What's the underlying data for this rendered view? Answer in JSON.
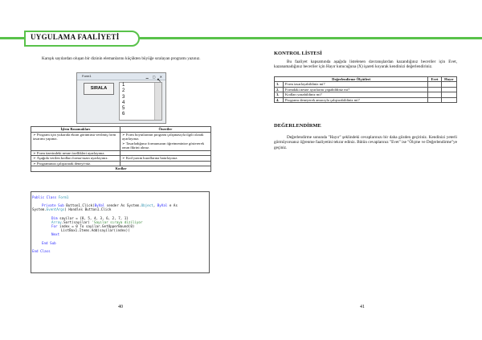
{
  "header": {
    "title": "UYGULAMA FAALİYETİ"
  },
  "left": {
    "intro": "Karışık sayılardan oluşan bir dizinin elemanlarını küçükten büyüğe sıralayan programı yazınız.",
    "window": {
      "title": "Form1",
      "button": "SIRALA",
      "items": [
        "1",
        "2",
        "3",
        "4",
        "5",
        "6"
      ]
    },
    "table": {
      "headers": [
        "İşlem Basamakları",
        "Öneriler"
      ],
      "rows": [
        [
          "➢ Program için yukarıda ekran görüntüsü verilmiş form tasarımı yapınız.",
          "➢ Form boyutlarının program çalışmasıyla ilgili olarak ayarlayınız.\n➢ Tasarladığınız formunuzun öğretmeninize göstererek onun fikrini alınız."
        ],
        [
          "➢ Form üzerindeki nesne özellikleri ayarlayınız.",
          ""
        ],
        [
          "➢ Aşağıda verilen kodları forma-nızın uyarlayınız.",
          "➢ Kod yazım kurallarına hatırlayınız."
        ],
        [
          "➢ Programınızı çalıştırarak deneyi-niz.",
          ""
        ]
      ],
      "code_header": "Kodlar"
    },
    "code": {
      "l1a": "Public Class ",
      "l1b": "Form1",
      "l2a": "Private Sub ",
      "l2b": "Button1_Click(",
      "l2c": "ByVal ",
      "l2d": "sender As System.",
      "l2e": "Object",
      ", ": "",
      "l2f": ", ",
      "l2g": "ByVal ",
      "l2h": "e As",
      "l3a": "System.",
      "l3b": "EventArgs",
      "l3c": ") Handles Button1.Click",
      "l4a": "Dim ",
      "l4b": "sayilar = {8, 5, 4, 3, 6, 2, 7, 1}",
      "l5a": "Array",
      "l5b": ".Sort(sayilar) ",
      "l5c": "'Sayılar sıraya diziliyor",
      "l6a": "For ",
      "l6b": "index = 0 To sayilar.GetUpperBound(0)",
      "l7": "ListBox1.Items.Add(sayilar(index))",
      "l8": "Next",
      "l9": "End Sub",
      "l10": "End Class"
    },
    "page_number": "40"
  },
  "right": {
    "checklist_title": "KONTROL LİSTESİ",
    "checklist_intro": "Bu faaliyet kapsamında aşağıda listelenen davranışlardan kazandığınız beceriler için Evet, kazanamadığınız beceriler için Hayır kutucuğuna (X) işareti koyarak kendinizi değerlendiriniz.",
    "checklist_headers": [
      "Değerlendirme Ölçütleri",
      "Evet",
      "Hayır"
    ],
    "checklist_rows": [
      {
        "num": "1.",
        "text": "Form tasarlayabildiniz mi?"
      },
      {
        "num": "2.",
        "text": "Formdaki nesne ayarlarını yapabildiniz mi?"
      },
      {
        "num": "3.",
        "text": "Kodları yazabildiniz mi?"
      },
      {
        "num": "4.",
        "text": "Programı deneyerek amacıyla çalıştırabildiniz mi?"
      }
    ],
    "eval_title": "DEĞERLENDİRME",
    "eval_text": "Değerlendirme sonunda \"Hayır\" şeklindeki cevaplarınızı bir daha gözden geçiriniz. Kendinizi yeterli görmüyorsanız öğrenme faaliyetini tekrar ediniz. Bütün cevaplarınız \"Evet\" ise \"Ölçme ve Değerlendirme\"ye geçiniz.",
    "page_number": "41"
  },
  "colors": {
    "accent": "#59c24a",
    "keyword": "#2a2aff",
    "type": "#2b91af",
    "comment": "#3a8a3a"
  }
}
